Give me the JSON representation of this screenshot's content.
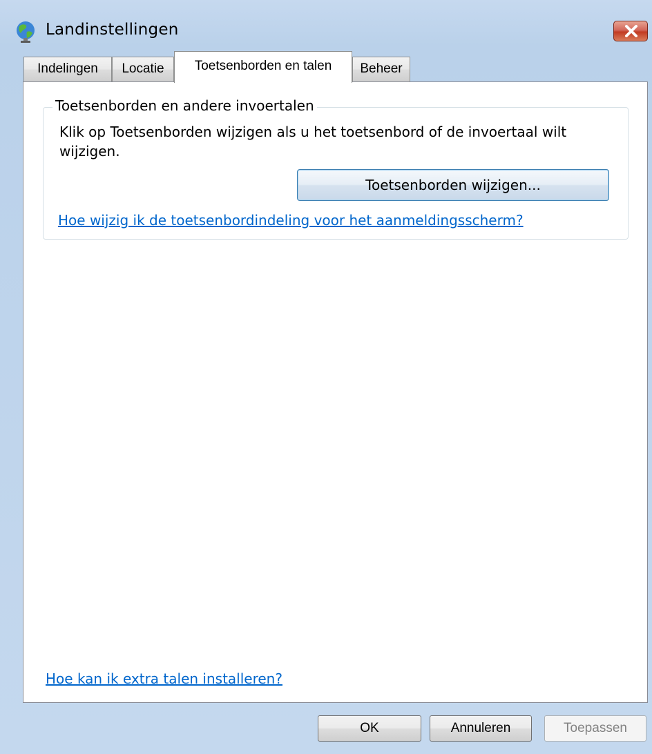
{
  "window": {
    "title": "Landinstellingen",
    "icon": "globe-regional-icon",
    "close_icon": "close-icon"
  },
  "tabs": [
    {
      "label": "Indelingen",
      "active": false
    },
    {
      "label": "Locatie",
      "active": false
    },
    {
      "label": "Toetsenborden en talen",
      "active": true
    },
    {
      "label": "Beheer",
      "active": false
    }
  ],
  "keyboards_group": {
    "legend": "Toetsenborden en andere invoertalen",
    "description": "Klik op Toetsenborden wijzigen als u het toetsenbord of de invoertaal wilt wijzigen.",
    "change_button": "Toetsenborden wijzigen...",
    "welcome_screen_link": "Hoe wijzig ik de toetsenbordindeling voor het aanmeldingsscherm?"
  },
  "install_languages_link": "Hoe kan ik extra talen installeren?",
  "buttons": {
    "ok": "OK",
    "cancel": "Annuleren",
    "apply": "Toepassen"
  },
  "colors": {
    "link": "#0066cc",
    "button_focus_border": "#3c7fb1",
    "close_button": "#c23b22"
  }
}
